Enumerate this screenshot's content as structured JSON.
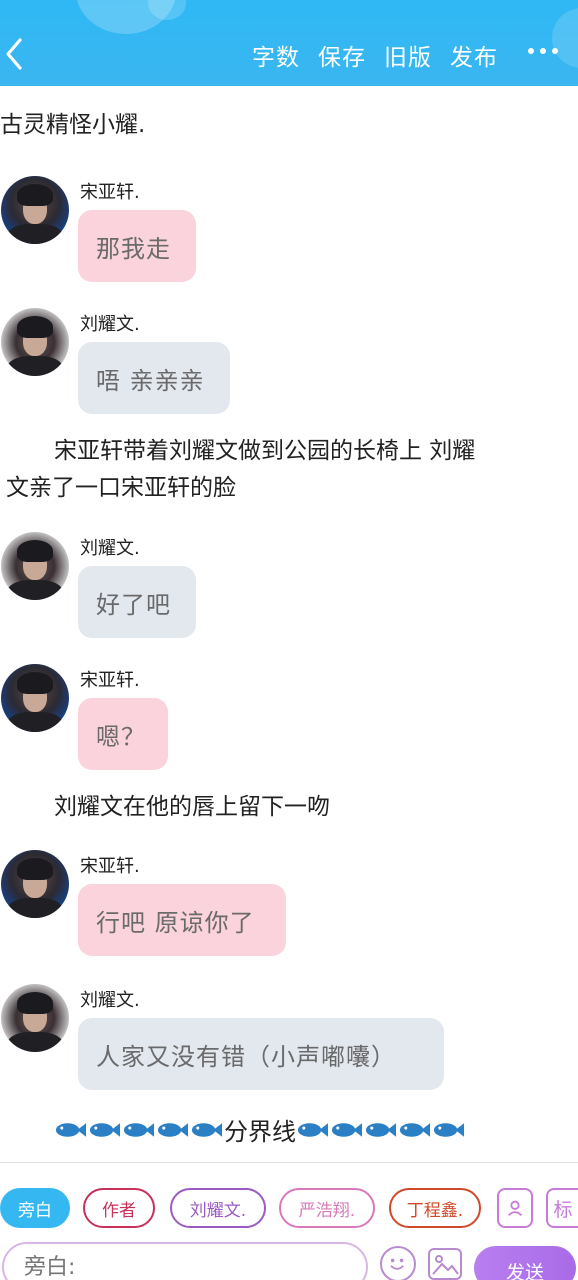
{
  "header": {
    "actions": [
      "字数",
      "保存",
      "旧版",
      "发布"
    ]
  },
  "story": {
    "intro": "古灵精怪小耀.",
    "messages": [
      {
        "speaker": "宋亚轩.",
        "text": "那我走",
        "style": "pink",
        "avatar": "song-avatar"
      },
      {
        "speaker": "刘耀文.",
        "text": "唔 亲亲亲",
        "style": "gray",
        "avatar": "liu-avatar"
      },
      {
        "speaker": "刘耀文.",
        "text": "好了吧",
        "style": "gray",
        "avatar": "liu-avatar"
      },
      {
        "speaker": "宋亚轩.",
        "text": "嗯？",
        "style": "pink",
        "avatar": "song-avatar"
      },
      {
        "speaker": "宋亚轩.",
        "text": "行吧 原谅你了",
        "style": "pink",
        "avatar": "song-avatar"
      },
      {
        "speaker": "刘耀文.",
        "text": "人家又没有错（小声嘟囔）",
        "style": "gray",
        "avatar": "liu-avatar"
      }
    ],
    "narration1_line1": "宋亚轩带着刘耀文做到公园的长椅上 刘耀",
    "narration1_line2": "文亲了一口宋亚轩的脸",
    "narration2": "刘耀文在他的唇上留下一吻",
    "divider_label": "分界线"
  },
  "toolbar": {
    "chips": [
      "旁白",
      "作者",
      "刘耀文.",
      "严浩翔.",
      "丁程鑫."
    ],
    "tag_icon_label": "标",
    "input_placeholder": "旁白:",
    "send_label": "发送"
  },
  "colors": {
    "header": "#35b8f2",
    "pink_bubble": "#fbd3dc",
    "gray_bubble": "#e3e7ee",
    "send": "#b07ae8"
  }
}
